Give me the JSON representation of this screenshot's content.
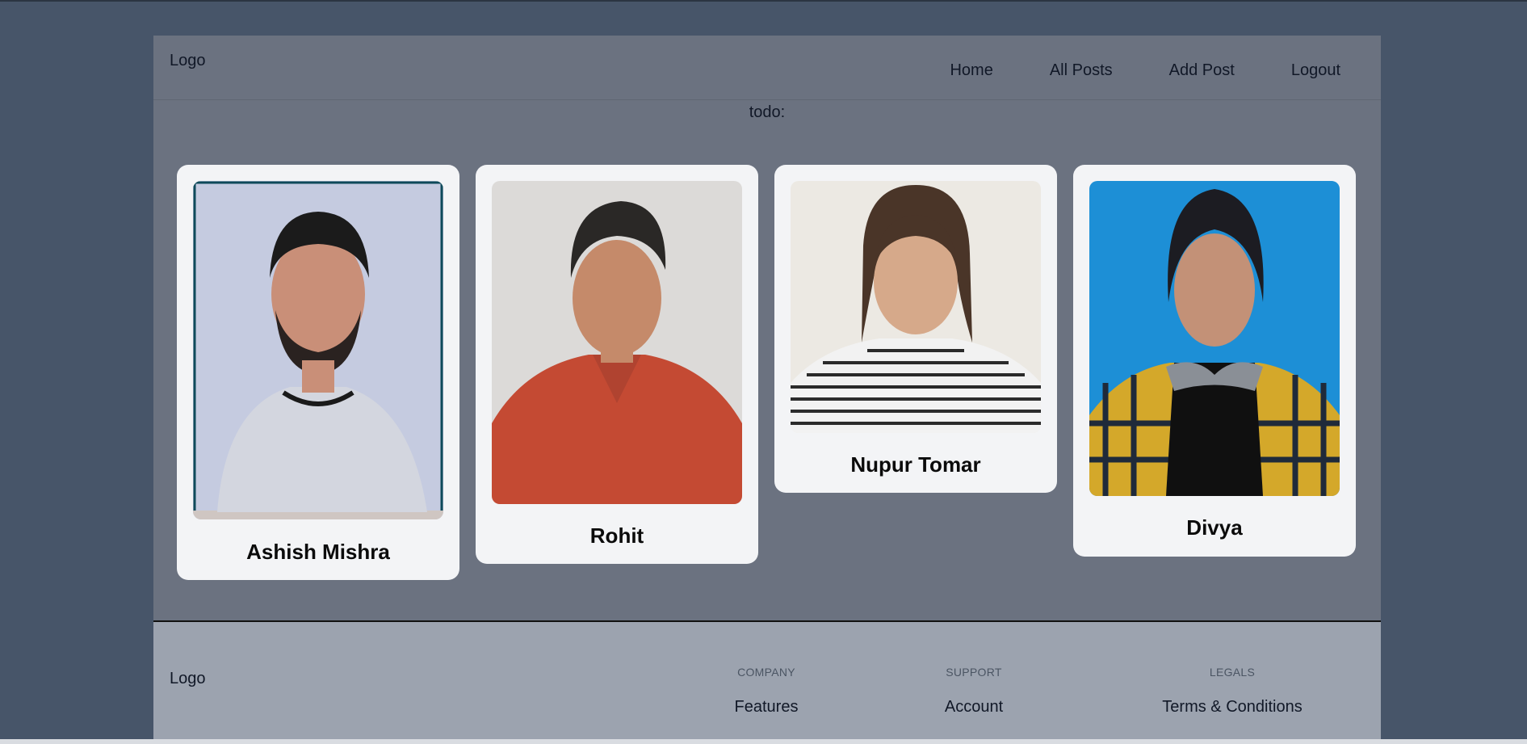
{
  "header": {
    "logo": "Logo",
    "nav": [
      "Home",
      "All Posts",
      "Add Post",
      "Logout"
    ]
  },
  "main": {
    "todo_text": "todo:",
    "cards": [
      {
        "name": "Ashish Mishra"
      },
      {
        "name": "Rohit"
      },
      {
        "name": "Nupur Tomar"
      },
      {
        "name": "Divya"
      }
    ]
  },
  "footer": {
    "logo": "Logo",
    "columns": [
      {
        "heading": "COMPANY",
        "link": "Features"
      },
      {
        "heading": "SUPPORT",
        "link": "Account"
      },
      {
        "heading": "LEGALS",
        "link": "Terms & Conditions"
      }
    ]
  },
  "colors": {
    "page_background": "#475569",
    "container_background": "#6b7280",
    "card_background": "#f3f4f6",
    "footer_background": "#9ca3af"
  }
}
